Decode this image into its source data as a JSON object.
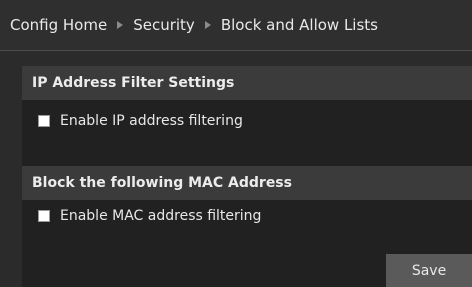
{
  "breadcrumb": {
    "items": [
      "Config Home",
      "Security",
      "Block and Allow Lists"
    ]
  },
  "ip_filter": {
    "title": "IP Address Filter Settings",
    "checkbox_label": "Enable IP address filtering",
    "checked": false
  },
  "mac_filter": {
    "title": "Block the following MAC Address",
    "checkbox_label": "Enable MAC address filtering",
    "checked": false
  },
  "actions": {
    "save_label": "Save"
  }
}
